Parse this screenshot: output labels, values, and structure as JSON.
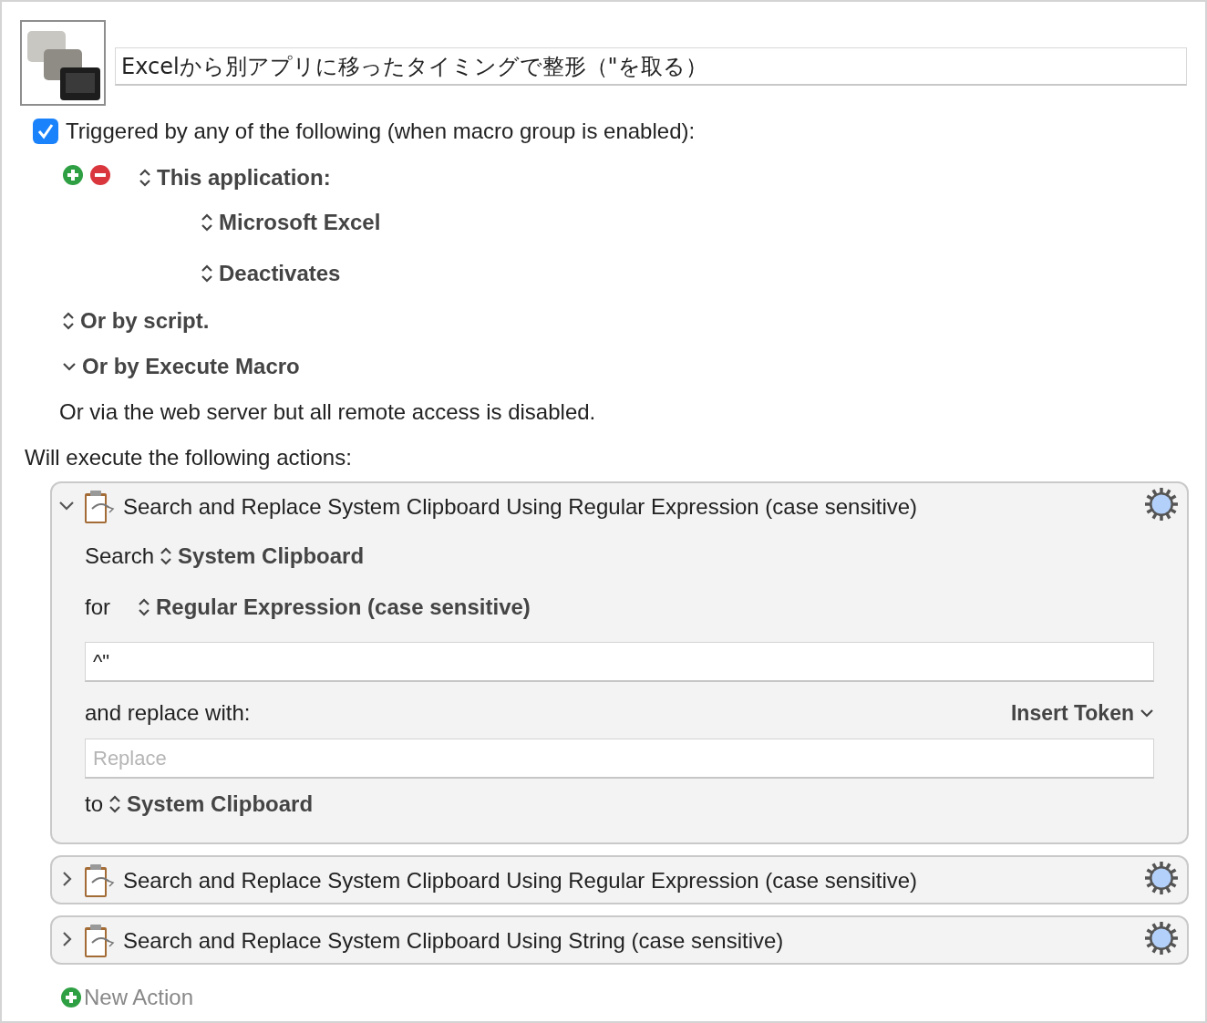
{
  "macro": {
    "name": "Excelから別アプリに移ったタイミングで整形（\"を取る）"
  },
  "trigger": {
    "checked": true,
    "label": "Triggered by any of the following (when macro group is enabled):"
  },
  "app_trigger": {
    "label": "This application:",
    "rows": [
      "Microsoft Excel",
      "Deactivates"
    ]
  },
  "trigger_options": [
    {
      "kind": "popup",
      "label": "Or by script."
    },
    {
      "kind": "menu",
      "label": "Or by Execute Macro"
    }
  ],
  "web_note": "Or via the web server but all remote access is disabled.",
  "actions_heading": "Will execute the following actions:",
  "actions": [
    {
      "title": "Search and Replace System Clipboard Using Regular Expression (case sensitive)",
      "expanded": true,
      "search_label": "Search",
      "search_source": "System Clipboard",
      "for_label": "for",
      "match_type": "Regular Expression (case sensitive)",
      "pattern": "^\"",
      "replace_label": "and replace with:",
      "insert_token": "Insert Token",
      "replace_placeholder": "Replace",
      "to_label": "to",
      "destination": "System Clipboard"
    },
    {
      "title": "Search and Replace System Clipboard Using Regular Expression (case sensitive)",
      "expanded": false
    },
    {
      "title": "Search and Replace System Clipboard Using String (case sensitive)",
      "expanded": false
    }
  ],
  "new_action": "New Action"
}
